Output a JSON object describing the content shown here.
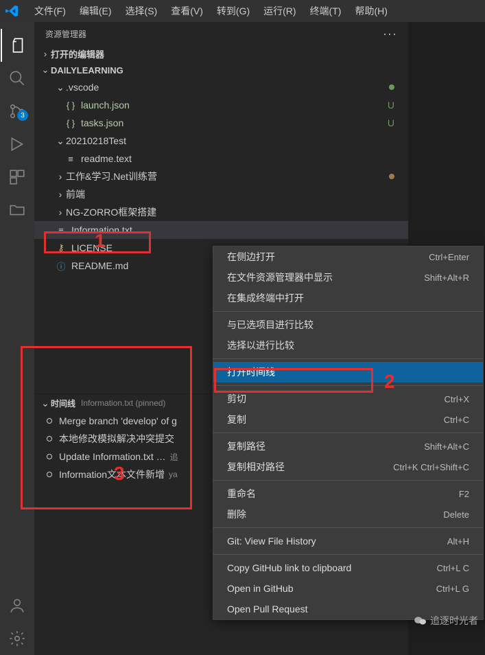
{
  "menubar": {
    "items": [
      "文件(F)",
      "编辑(E)",
      "选择(S)",
      "查看(V)",
      "转到(G)",
      "运行(R)",
      "终端(T)",
      "帮助(H)"
    ]
  },
  "activity_bar": {
    "scm_badge": "3"
  },
  "explorer": {
    "title": "资源管理器",
    "open_editors": "打开的编辑器",
    "root": "DAILYLEARNING",
    "items": [
      {
        "type": "folder",
        "name": ".vscode",
        "depth": 1,
        "expanded": true,
        "status_dot": "#6a9955"
      },
      {
        "type": "file",
        "name": "launch.json",
        "depth": 2,
        "icon": "{ }",
        "icon_color": "#b5cea8",
        "label_color": "#b5cea8",
        "status_letter": "U",
        "status_color": "#6a9955"
      },
      {
        "type": "file",
        "name": "tasks.json",
        "depth": 2,
        "icon": "{ }",
        "icon_color": "#b5cea8",
        "label_color": "#b5cea8",
        "status_letter": "U",
        "status_color": "#6a9955"
      },
      {
        "type": "folder",
        "name": "20210218Test",
        "depth": 1,
        "expanded": true
      },
      {
        "type": "file",
        "name": "readme.text",
        "depth": 2,
        "icon": "≡",
        "icon_color": "#cccccc"
      },
      {
        "type": "folder",
        "name": "工作&学习.Net训练营",
        "depth": 1,
        "expanded": false,
        "status_dot": "#a07c4a"
      },
      {
        "type": "folder",
        "name": "前端",
        "depth": 1,
        "expanded": false
      },
      {
        "type": "folder",
        "name": "NG-ZORRO框架搭建",
        "depth": 1,
        "expanded": false
      },
      {
        "type": "file",
        "name": "Information.txt",
        "depth": 1,
        "icon": "≡",
        "icon_color": "#cccccc",
        "selected": true
      },
      {
        "type": "file",
        "name": "LICENSE",
        "depth": 1,
        "icon": "⚷",
        "icon_color": "#d7ba7d"
      },
      {
        "type": "file",
        "name": "README.md",
        "depth": 1,
        "icon": "ⓘ",
        "icon_color": "#519aba"
      }
    ]
  },
  "timeline": {
    "title": "时间线",
    "subtitle": "Information.txt (pinned)",
    "items": [
      {
        "msg": "Merge branch 'develop' of g",
        "author": ""
      },
      {
        "msg": "本地修改模拟解决冲突提交",
        "author": ""
      },
      {
        "msg": "Update Information.txt …",
        "author": "追"
      },
      {
        "msg": "Information文本文件新增",
        "author": "ya"
      }
    ]
  },
  "context_menu": {
    "groups": [
      [
        {
          "label": "在侧边打开",
          "shortcut": "Ctrl+Enter"
        },
        {
          "label": "在文件资源管理器中显示",
          "shortcut": "Shift+Alt+R"
        },
        {
          "label": "在集成终端中打开",
          "shortcut": ""
        }
      ],
      [
        {
          "label": "与已选项目进行比较",
          "shortcut": ""
        },
        {
          "label": "选择以进行比较",
          "shortcut": ""
        }
      ],
      [
        {
          "label": "打开时间线",
          "shortcut": "",
          "highlighted": true
        }
      ],
      [
        {
          "label": "剪切",
          "shortcut": "Ctrl+X"
        },
        {
          "label": "复制",
          "shortcut": "Ctrl+C"
        }
      ],
      [
        {
          "label": "复制路径",
          "shortcut": "Shift+Alt+C"
        },
        {
          "label": "复制相对路径",
          "shortcut": "Ctrl+K Ctrl+Shift+C"
        }
      ],
      [
        {
          "label": "重命名",
          "shortcut": "F2"
        },
        {
          "label": "删除",
          "shortcut": "Delete"
        }
      ],
      [
        {
          "label": "Git: View File History",
          "shortcut": "Alt+H"
        }
      ],
      [
        {
          "label": "Copy GitHub link to clipboard",
          "shortcut": "Ctrl+L C"
        },
        {
          "label": "Open in GitHub",
          "shortcut": "Ctrl+L G"
        },
        {
          "label": "Open Pull Request",
          "shortcut": ""
        }
      ]
    ]
  },
  "annotations": {
    "label1": "1",
    "label2": "2",
    "label3": "3"
  },
  "watermark": {
    "text": "追逐时光者"
  }
}
